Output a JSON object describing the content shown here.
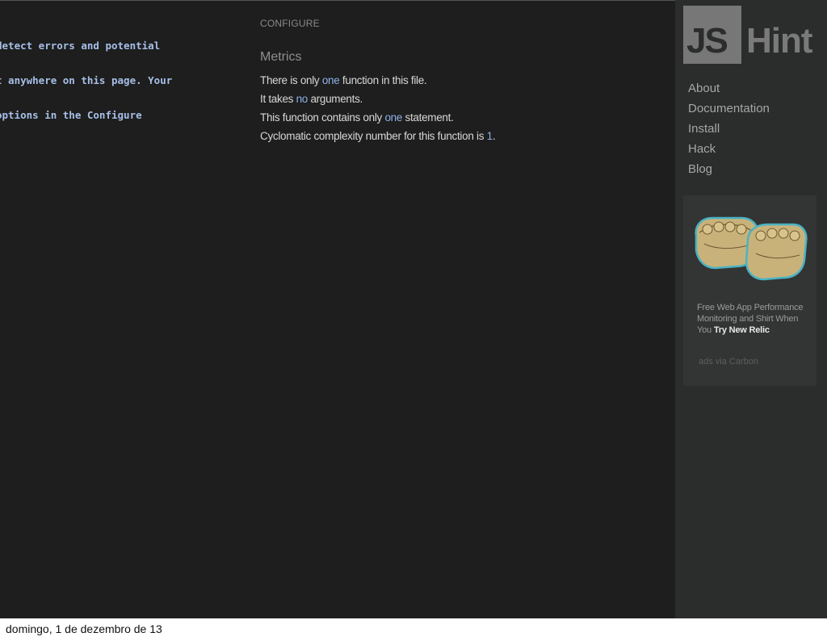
{
  "code_lines": [
    "detect errors and potential",
    "t anywhere on this page. Your",
    "options in the Configure"
  ],
  "report": {
    "section_title": "CONFIGURE",
    "metrics_heading": "Metrics",
    "lines": [
      {
        "before": "There is only ",
        "highlight": "one",
        "after": " function in this file."
      },
      {
        "before": "It takes ",
        "highlight": "no",
        "after": " arguments."
      },
      {
        "before": "This function contains only ",
        "highlight": "one",
        "after": " statement."
      },
      {
        "before": "Cyclomatic complexity number for this function is ",
        "highlight": "1",
        "after": "."
      }
    ]
  },
  "sidebar": {
    "logo_left": "JS",
    "logo_right": "Hint",
    "nav": [
      "About",
      "Documentation",
      "Install",
      "Hack",
      "Blog"
    ],
    "ad": {
      "text": "Free Web App Performance Monitoring and Shirt When You ",
      "cta": "Try New Relic",
      "via": "ads via Carbon"
    }
  },
  "footer": {
    "date": "domingo, 1 de dezembro de 13"
  },
  "colors": {
    "background": "#1d1e1d",
    "sidebar": "#2b2c2c",
    "highlight": "#8fb0ea",
    "code": "#a7bfe8"
  }
}
